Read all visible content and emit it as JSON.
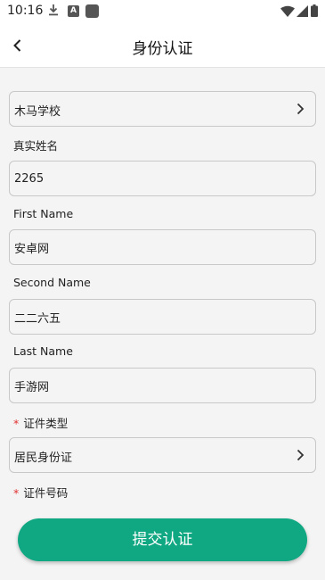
{
  "status_bar": {
    "time": "10:16",
    "icons": [
      "download-icon",
      "a-icon",
      "square-icon",
      "wifi-icon",
      "signal-icon",
      "battery-icon"
    ],
    "a_icon_text": "A"
  },
  "header": {
    "title": "身份认证",
    "back_icon": "chevron-left-icon"
  },
  "form": {
    "school": {
      "value": "木马学校"
    },
    "real_name": {
      "label": "真实姓名",
      "value": "2265"
    },
    "first_name": {
      "label": "First Name",
      "value": "安卓网"
    },
    "second_name": {
      "label": "Second Name",
      "value": "二二六五"
    },
    "last_name": {
      "label": "Last Name",
      "value": "手游网"
    },
    "id_type": {
      "required_mark": "*",
      "label": "证件类型",
      "value": "居民身份证"
    },
    "id_number": {
      "required_mark": "*",
      "label": "证件号码"
    }
  },
  "submit_label": "提交认证",
  "colors": {
    "accent": "#0fa882",
    "required": "#e0312f",
    "background": "#f4f4f4",
    "border": "#c8c8c8"
  }
}
